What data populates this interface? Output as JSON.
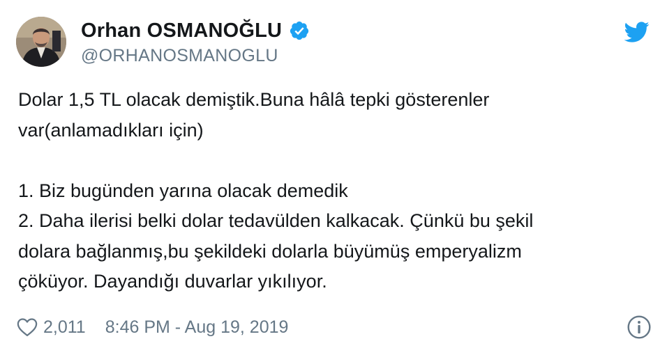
{
  "author": {
    "display_name": "Orhan OSMANOĞLU",
    "handle": "@ORHANOSMANOGLU",
    "verified": true
  },
  "tweet": {
    "lines": [
      "Dolar 1,5 TL olacak demiştik.Buna hâlâ tepki gösterenler",
      "var(anlamadıkları için)",
      "",
      "1. Biz bugünden yarına olacak demedik",
      "2. Daha ilerisi belki dolar tedavülden kalkacak. Çünkü bu şekil",
      "dolara bağlanmış,bu şekildeki dolarla büyümüş emperyalizm",
      "çöküyor. Dayandığı duvarlar yıkılıyor."
    ]
  },
  "footer": {
    "likes": "2,011",
    "timestamp": "8:46 PM - Aug 19, 2019"
  },
  "icons": {
    "like": "heart-icon",
    "verified": "verified-badge-icon",
    "brand": "twitter-bird-icon",
    "info": "info-icon"
  },
  "colors": {
    "brand_blue": "#1da1f2",
    "text": "#14171a",
    "secondary": "#657786"
  }
}
